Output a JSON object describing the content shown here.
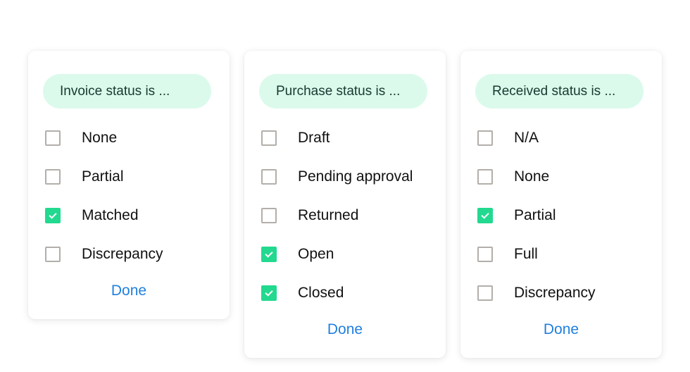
{
  "panels": [
    {
      "title": "Invoice status is ...",
      "options": [
        {
          "label": "None",
          "checked": false
        },
        {
          "label": "Partial",
          "checked": false
        },
        {
          "label": "Matched",
          "checked": true
        },
        {
          "label": "Discrepancy",
          "checked": false
        }
      ],
      "done_label": "Done"
    },
    {
      "title": "Purchase status is ...",
      "options": [
        {
          "label": "Draft",
          "checked": false
        },
        {
          "label": "Pending approval",
          "checked": false
        },
        {
          "label": "Returned",
          "checked": false
        },
        {
          "label": "Open",
          "checked": true
        },
        {
          "label": "Closed",
          "checked": true
        }
      ],
      "done_label": "Done"
    },
    {
      "title": "Received status is ...",
      "options": [
        {
          "label": "N/A",
          "checked": false
        },
        {
          "label": "None",
          "checked": false
        },
        {
          "label": "Partial",
          "checked": true
        },
        {
          "label": "Full",
          "checked": false
        },
        {
          "label": "Discrepancy",
          "checked": false
        }
      ],
      "done_label": "Done"
    }
  ],
  "colors": {
    "pill_bg": "#dbfaec",
    "checked": "#22d98f",
    "link": "#1f7fdf"
  }
}
